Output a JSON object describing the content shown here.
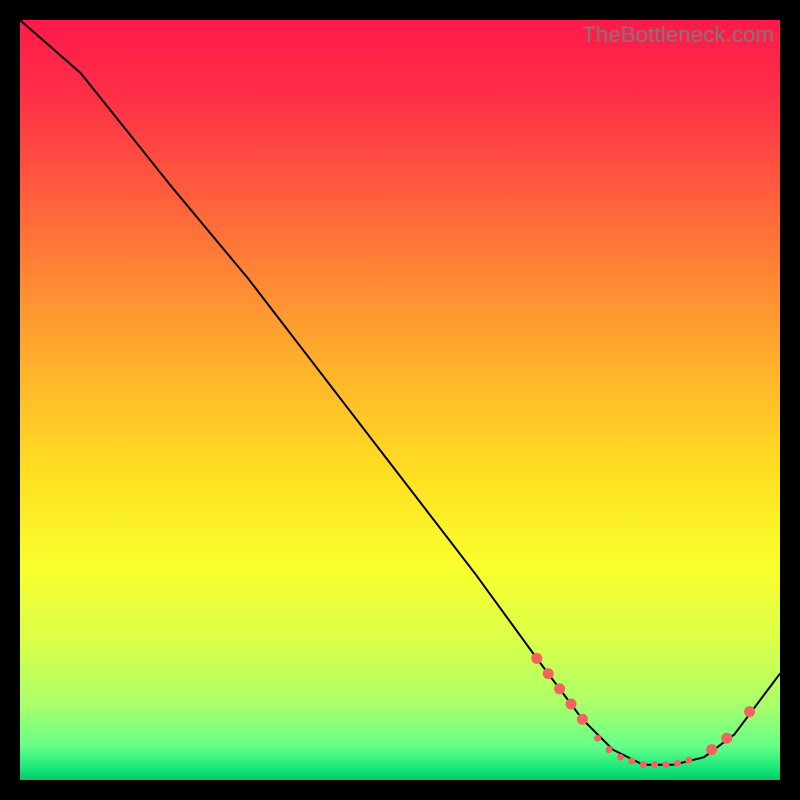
{
  "watermark": "TheBottleneck.com",
  "chart_data": {
    "type": "line",
    "title": "",
    "xlabel": "",
    "ylabel": "",
    "xlim": [
      0,
      100
    ],
    "ylim": [
      0,
      100
    ],
    "grid": false,
    "legend": false,
    "series": [
      {
        "name": "bottleneck-curve",
        "x": [
          0,
          8,
          20,
          30,
          40,
          50,
          60,
          68,
          74,
          78,
          82,
          86,
          90,
          94,
          100
        ],
        "y": [
          100,
          93,
          78,
          66,
          53,
          40,
          27,
          16,
          8,
          4,
          2,
          2,
          3,
          6,
          14
        ],
        "stroke": "#000000",
        "stroke_width": 2
      }
    ],
    "markers": [
      {
        "name": "highlight-dots",
        "color": "#f4645f",
        "radius_small": 3.5,
        "radius_large": 5.5,
        "points": [
          {
            "x": 68.0,
            "y": 16.0,
            "r": "large"
          },
          {
            "x": 69.5,
            "y": 14.0,
            "r": "large"
          },
          {
            "x": 71.0,
            "y": 12.0,
            "r": "large"
          },
          {
            "x": 72.5,
            "y": 10.0,
            "r": "large"
          },
          {
            "x": 74.0,
            "y": 8.0,
            "r": "large"
          },
          {
            "x": 76.0,
            "y": 5.5,
            "r": "small"
          },
          {
            "x": 77.5,
            "y": 4.0,
            "r": "small"
          },
          {
            "x": 79.0,
            "y": 3.0,
            "r": "small"
          },
          {
            "x": 80.5,
            "y": 2.5,
            "r": "small"
          },
          {
            "x": 82.0,
            "y": 2.0,
            "r": "small"
          },
          {
            "x": 83.5,
            "y": 2.0,
            "r": "small"
          },
          {
            "x": 85.0,
            "y": 2.0,
            "r": "small"
          },
          {
            "x": 86.5,
            "y": 2.2,
            "r": "small"
          },
          {
            "x": 88.0,
            "y": 2.6,
            "r": "small"
          },
          {
            "x": 91.0,
            "y": 4.0,
            "r": "large"
          },
          {
            "x": 93.0,
            "y": 5.5,
            "r": "large"
          },
          {
            "x": 96.0,
            "y": 9.0,
            "r": "large"
          }
        ]
      }
    ],
    "background_gradient": {
      "stops": [
        {
          "offset": 0.0,
          "color": "#ff1a4b"
        },
        {
          "offset": 0.1,
          "color": "#ff2f47"
        },
        {
          "offset": 0.22,
          "color": "#ff5a3e"
        },
        {
          "offset": 0.35,
          "color": "#ff8b34"
        },
        {
          "offset": 0.48,
          "color": "#ffb92a"
        },
        {
          "offset": 0.6,
          "color": "#ffe022"
        },
        {
          "offset": 0.72,
          "color": "#f9ff2d"
        },
        {
          "offset": 0.82,
          "color": "#d9ff4a"
        },
        {
          "offset": 0.9,
          "color": "#aaff6a"
        },
        {
          "offset": 0.955,
          "color": "#66ff88"
        },
        {
          "offset": 0.985,
          "color": "#19e77a"
        },
        {
          "offset": 1.0,
          "color": "#00c86a"
        }
      ]
    }
  }
}
